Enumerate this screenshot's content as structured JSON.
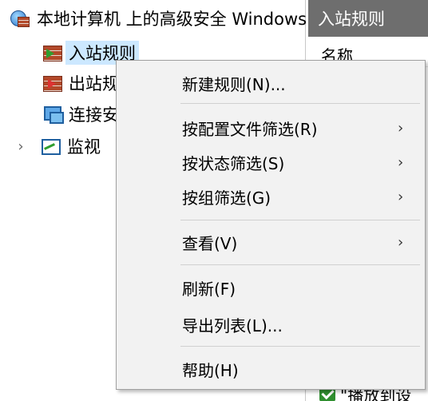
{
  "tree": {
    "root_label": "本地计算机 上的高级安全 Windows Defender 防火墙",
    "items": [
      {
        "label": "入站规则",
        "selected": true,
        "icon": "inbound-rules-icon"
      },
      {
        "label": "出站规则",
        "selected": false,
        "icon": "outbound-rules-icon"
      },
      {
        "label": "连接安全规则",
        "selected": false,
        "icon": "connection-security-icon"
      },
      {
        "label": "监视",
        "selected": false,
        "icon": "monitor-icon",
        "expander": "›"
      }
    ]
  },
  "right_pane": {
    "header": "入站规则",
    "column_header": "名称",
    "bottom_rule": "\"播放到设"
  },
  "context_menu": {
    "items": [
      {
        "label": "新建规则(N)...",
        "submenu": false
      },
      {
        "label": "按配置文件筛选(R)",
        "submenu": true
      },
      {
        "label": "按状态筛选(S)",
        "submenu": true
      },
      {
        "label": "按组筛选(G)",
        "submenu": true
      },
      {
        "label": "查看(V)",
        "submenu": true
      },
      {
        "label": "刷新(F)",
        "submenu": false
      },
      {
        "label": "导出列表(L)...",
        "submenu": false
      },
      {
        "label": "帮助(H)",
        "submenu": false
      }
    ],
    "submenu_arrow": "›"
  },
  "colors": {
    "header_bg": "#6e6e6e",
    "selection_bg": "#cce8ff",
    "menu_bg": "#f2f2f2"
  }
}
